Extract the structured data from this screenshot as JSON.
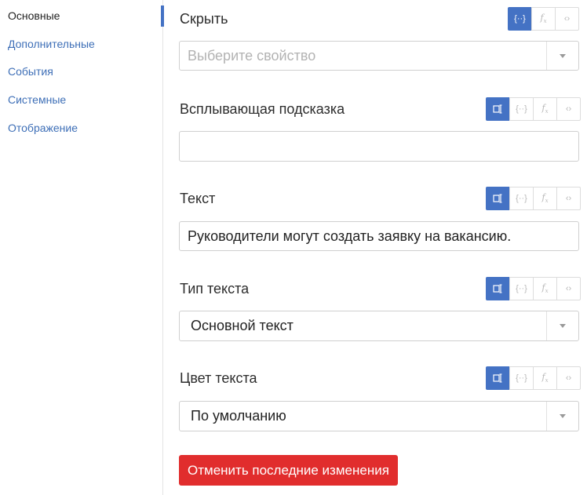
{
  "sidebar": {
    "items": [
      {
        "label": "Основные",
        "active": true
      },
      {
        "label": "Дополнительные"
      },
      {
        "label": "События"
      },
      {
        "label": "Системные"
      },
      {
        "label": "Отображение"
      }
    ]
  },
  "form": {
    "hide": {
      "label": "Скрыть",
      "placeholder": "Выберите свойство"
    },
    "tooltip": {
      "label": "Всплывающая подсказка",
      "value": ""
    },
    "text": {
      "label": "Текст",
      "value": "Руководители могут создать заявку на вакансию."
    },
    "text_type": {
      "label": "Тип текста",
      "value": "Основной текст"
    },
    "text_color": {
      "label": "Цвет текста",
      "value": "По умолчанию"
    }
  },
  "toolbar_icons": {
    "text_mode": "text-cursor-icon",
    "binding": "curly-braces-icon",
    "formula": "fx-icon",
    "code": "code-brackets-icon"
  },
  "actions": {
    "revert_label": "Отменить последние изменения"
  },
  "colors": {
    "accent": "#4472c4",
    "danger": "#e12d2d",
    "link": "#3e6fb7"
  }
}
